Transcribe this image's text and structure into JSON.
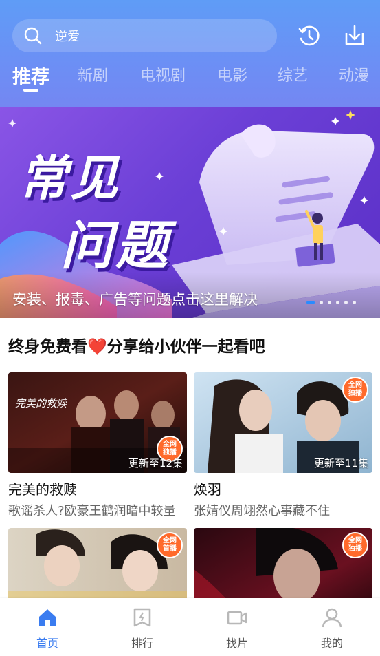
{
  "header": {
    "search_text": "逆爱",
    "icons": [
      "history-icon",
      "download-icon"
    ]
  },
  "tabs": [
    {
      "label": "推荐",
      "active": true
    },
    {
      "label": "新剧",
      "active": false
    },
    {
      "label": "电视剧",
      "active": false
    },
    {
      "label": "电影",
      "active": false
    },
    {
      "label": "综艺",
      "active": false
    },
    {
      "label": "动漫",
      "active": false
    }
  ],
  "banner": {
    "headline_1": "常见",
    "headline_2": "问题",
    "caption": "安装、报毒、广告等问题点击这里解决",
    "dot_count": 6,
    "active_dot": 0
  },
  "section": {
    "title_part1": "终身免费看",
    "heart": "❤️",
    "title_part2": "分享给小伙伴一起看吧"
  },
  "cards": [
    {
      "title": "完美的救赎",
      "desc": "歌谣杀人?欧豪王鹤润暗中较量",
      "episode": "更新至12集",
      "badge": [
        "全网",
        "独播"
      ],
      "poster_text": "完美的救赎"
    },
    {
      "title": "焕羽",
      "desc": "张婧仪周翊然心事藏不住",
      "episode": "更新至11集",
      "badge": [
        "全网",
        "独播"
      ]
    },
    {
      "title": "",
      "desc": "",
      "episode": "",
      "badge": [
        "全网",
        "首播"
      ]
    },
    {
      "title": "",
      "desc": "",
      "episode": "",
      "badge": [
        "全网",
        "独播"
      ]
    }
  ],
  "bottom_nav": [
    {
      "label": "首页",
      "active": true,
      "icon": "home-icon"
    },
    {
      "label": "排行",
      "active": false,
      "icon": "ranking-icon"
    },
    {
      "label": "找片",
      "active": false,
      "icon": "video-camera-icon"
    },
    {
      "label": "我的",
      "active": false,
      "icon": "user-icon"
    }
  ],
  "colors": {
    "header_top": "#5f9cf6",
    "accent": "#3a7cf0",
    "badge": "#ff6a2b",
    "banner": "#6b3fd6"
  }
}
